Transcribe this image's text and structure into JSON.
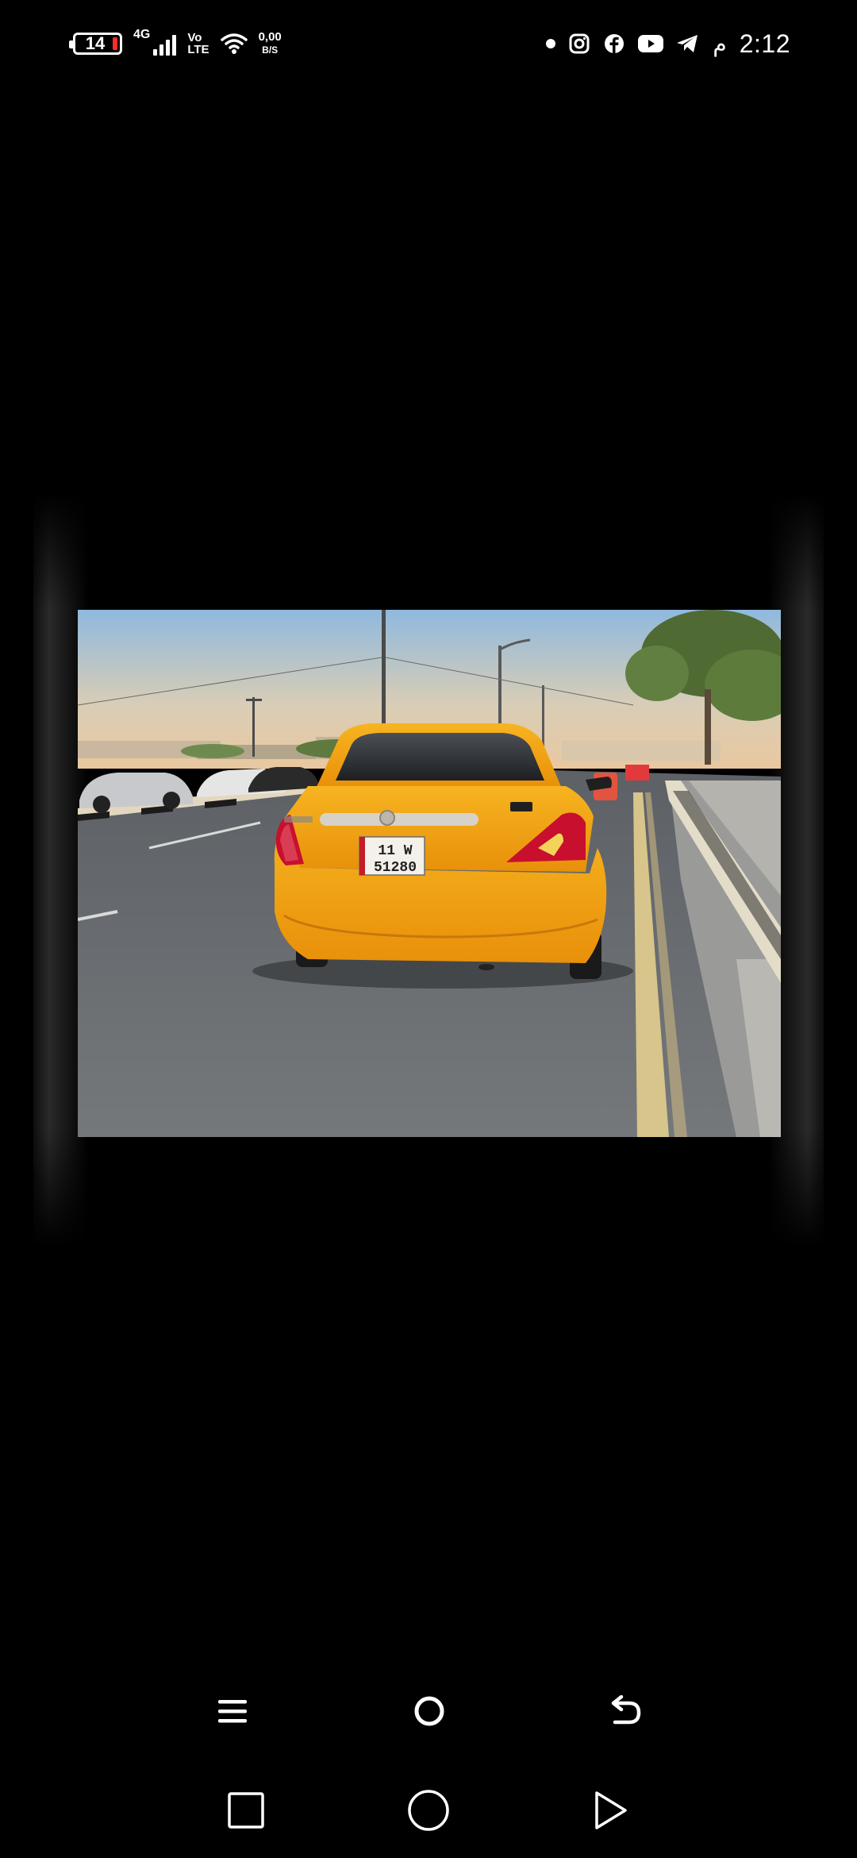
{
  "status_bar": {
    "battery_level": "14",
    "network_type": "4G",
    "volte_top": "Vo",
    "volte_bottom": "LTE",
    "speed_value": "0,00",
    "speed_unit": "B/S",
    "time": "2:12",
    "ampm": "م",
    "notification_icons": [
      "dot",
      "instagram-icon",
      "facebook-icon",
      "youtube-icon",
      "telegram-icon"
    ]
  },
  "photo": {
    "subject": "yellow taxi car",
    "plate_line1": "11 W",
    "plate_line2": "51280"
  },
  "viewer_nav": [
    "menu-icon",
    "home-circle-icon",
    "back-arrow-icon"
  ],
  "system_nav": [
    "recents-square-icon",
    "home-circle-icon",
    "back-triangle-icon"
  ],
  "colors": {
    "background": "#000000",
    "taxi": "#f5a513",
    "sky_top": "#8fb9de",
    "sky_bottom": "#e9c89f",
    "road": "#6b6e72"
  }
}
